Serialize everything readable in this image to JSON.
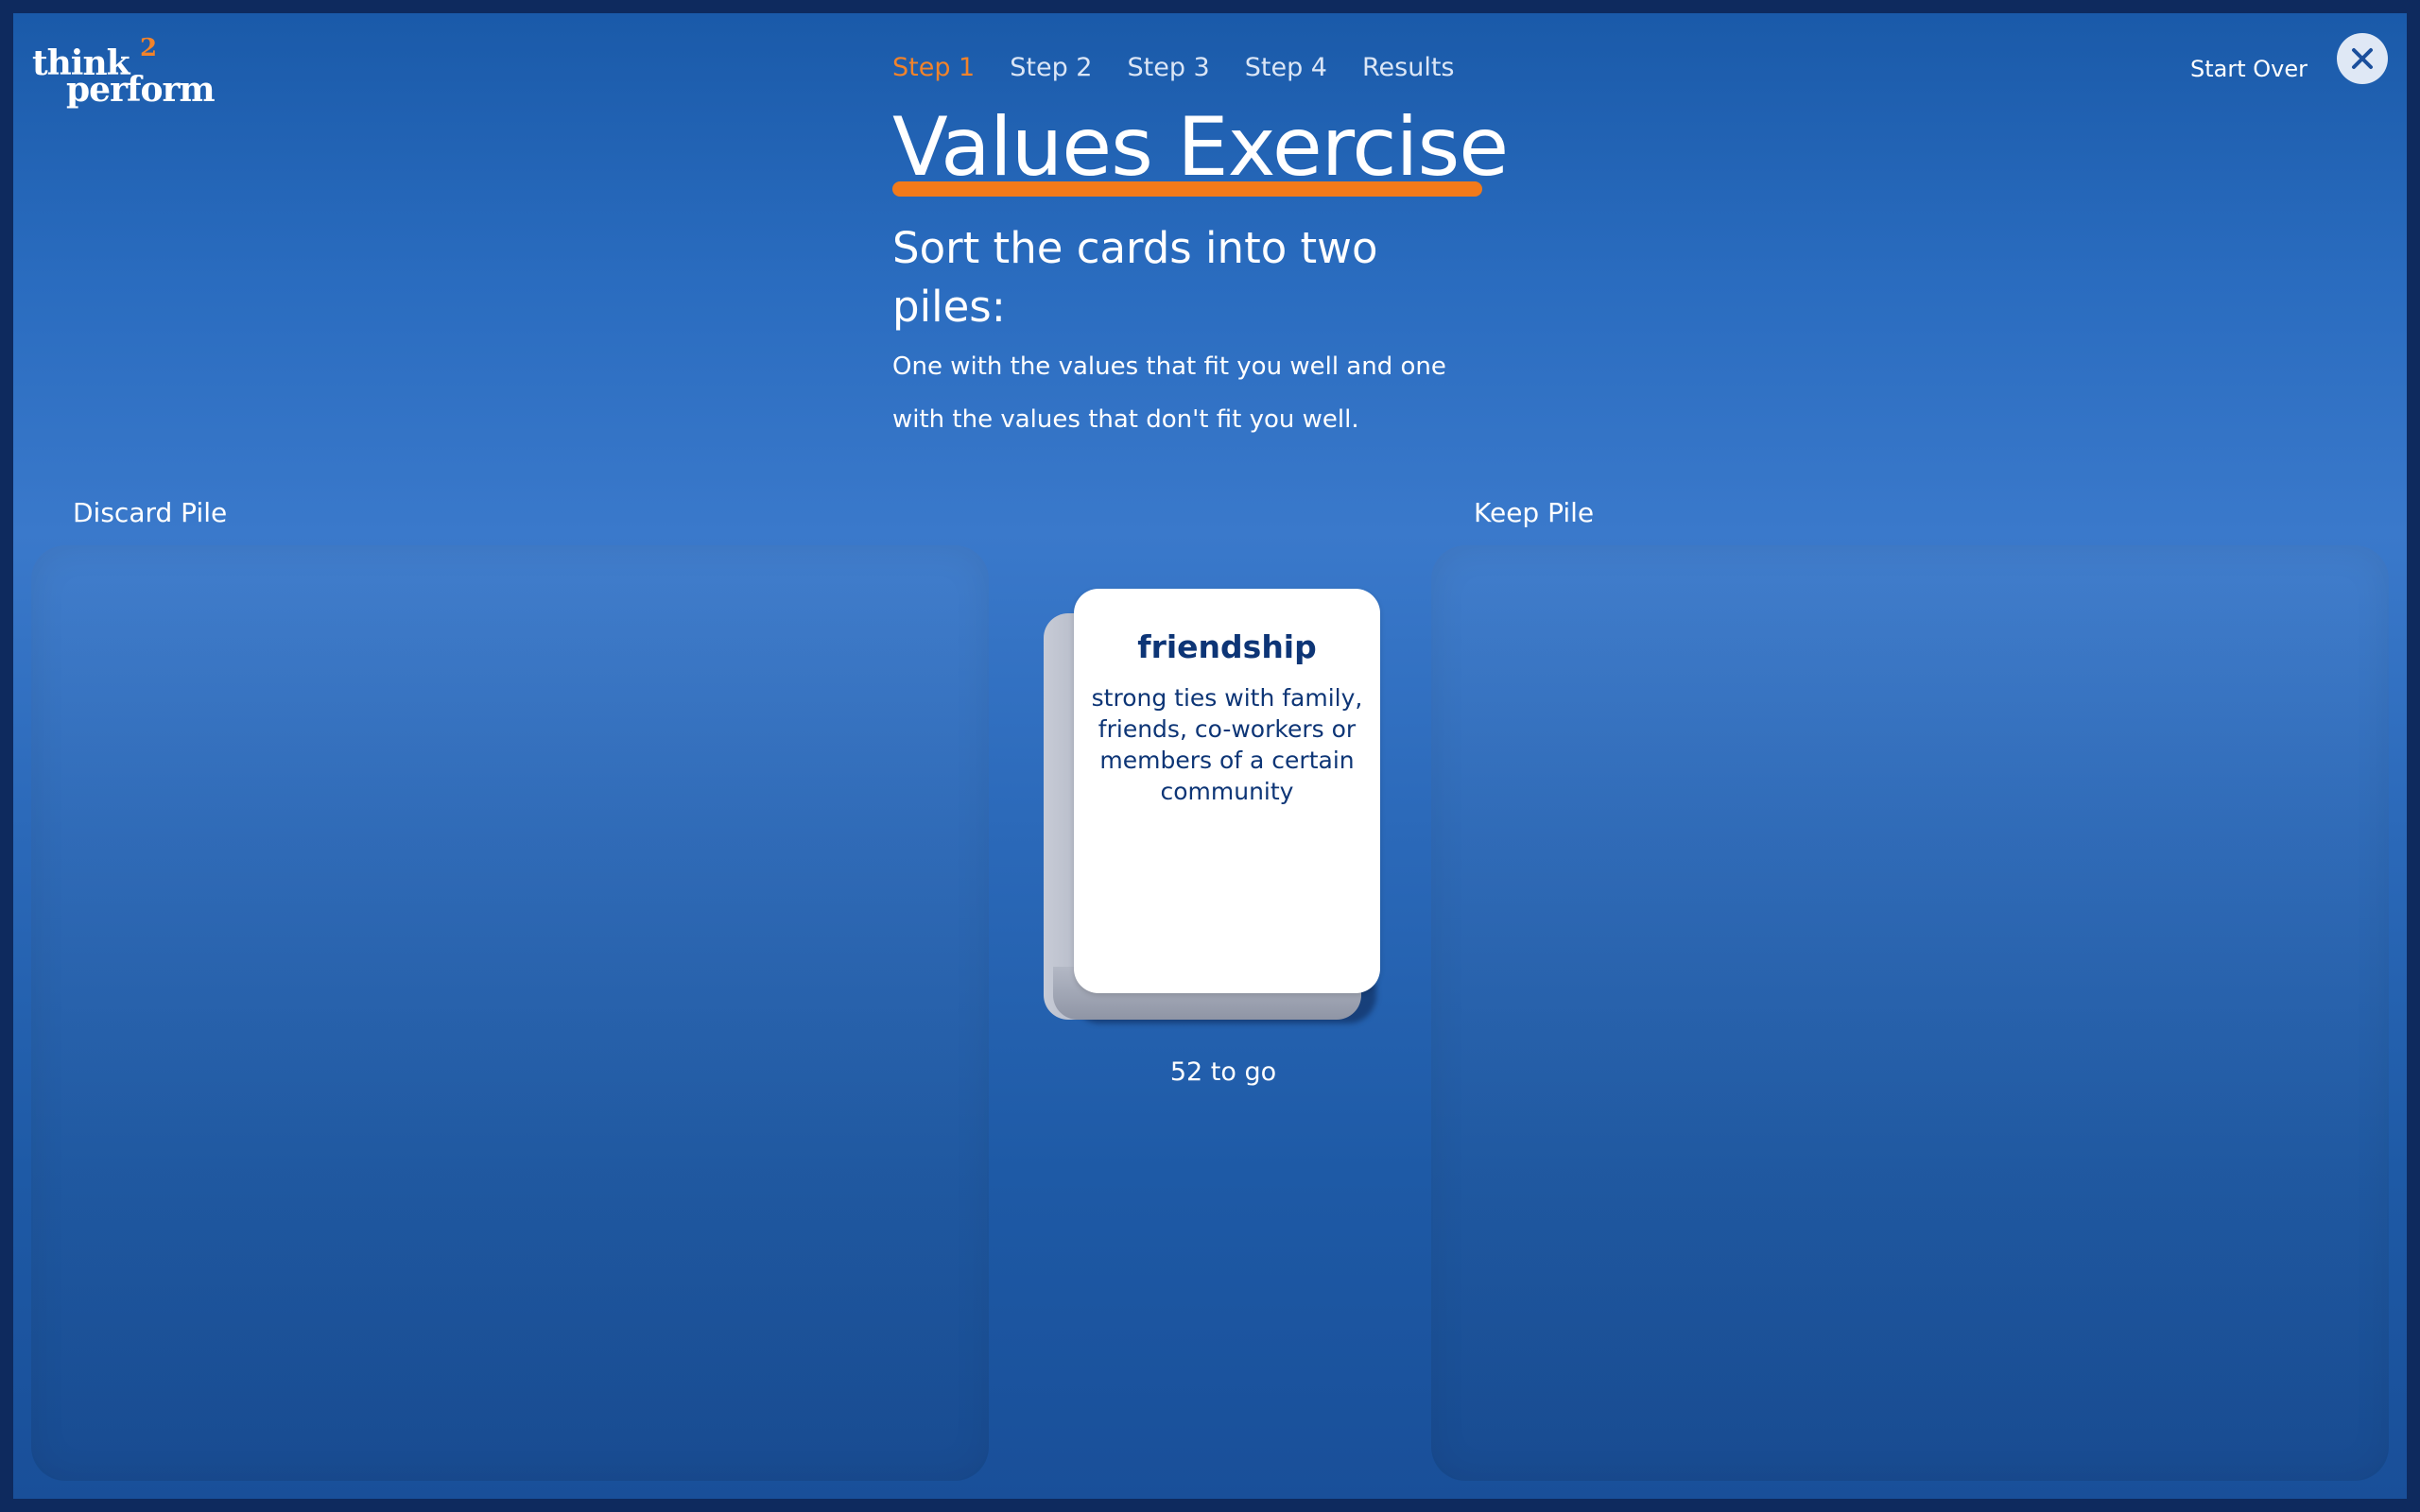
{
  "brand": {
    "logo_line1": "think",
    "logo_sup": "2",
    "logo_line2": "perform",
    "accent_color": "#f2832a"
  },
  "nav": {
    "steps": [
      {
        "label": "Step 1",
        "active": true
      },
      {
        "label": "Step 2",
        "active": false
      },
      {
        "label": "Step 3",
        "active": false
      },
      {
        "label": "Step 4",
        "active": false
      },
      {
        "label": "Results",
        "active": false
      }
    ],
    "start_over": "Start Over",
    "close_icon": "close-icon"
  },
  "header": {
    "title": "Values Exercise",
    "subtitle": "Sort the cards into two piles:",
    "description": "One with the values that fit you well and one with the values that don't fit you well."
  },
  "piles": {
    "discard_label": "Discard Pile",
    "keep_label": "Keep Pile"
  },
  "card": {
    "word": "friendship",
    "definition": "strong ties with family, friends, co-workers or members of a certain community"
  },
  "progress": {
    "remaining_text": "52 to go"
  }
}
